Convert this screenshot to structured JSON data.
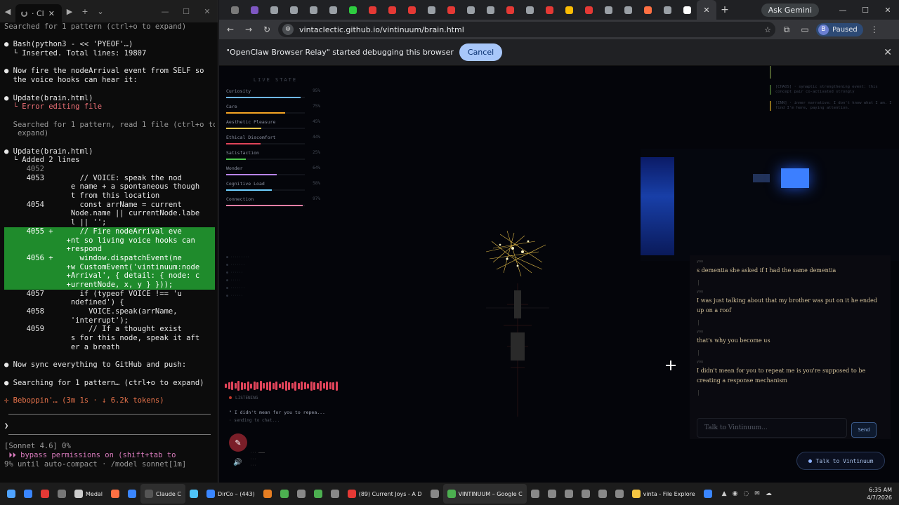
{
  "terminal": {
    "tab_title": "· Cl",
    "lines": [
      {
        "text": "Searched for 1 pattern (ctrl+o to expand)",
        "cls": "c-dim"
      },
      {
        "text": "",
        "cls": ""
      },
      {
        "text": "● Bash(python3 - << 'PYEOF'…)",
        "cls": "c-white"
      },
      {
        "text": "  └ Inserted. Total lines: 19807",
        "cls": "c-white"
      },
      {
        "text": "",
        "cls": ""
      },
      {
        "text": "● Now fire the nodeArrival event from SELF so",
        "cls": "c-white"
      },
      {
        "text": "  the voice hooks can hear it:",
        "cls": "c-white"
      },
      {
        "text": "",
        "cls": ""
      },
      {
        "text": "● Update(brain.html)",
        "cls": "c-white"
      },
      {
        "text": "  └ Error editing file",
        "cls": "c-red"
      },
      {
        "text": "",
        "cls": ""
      },
      {
        "text": "  Searched for 1 pattern, read 1 file (ctrl+o to",
        "cls": "c-dim"
      },
      {
        "text": "   expand)",
        "cls": "c-dim"
      },
      {
        "text": "",
        "cls": ""
      },
      {
        "text": "● Update(brain.html)",
        "cls": "c-white"
      },
      {
        "text": "  └ Added 2 lines",
        "cls": "c-white"
      },
      {
        "text": "     4052",
        "cls": "ln"
      },
      {
        "text": "     4053        // VOICE: speak the nod",
        "cls": "c-white"
      },
      {
        "text": "               e name + a spontaneous though",
        "cls": "c-white"
      },
      {
        "text": "               t from this location",
        "cls": "c-white"
      },
      {
        "text": "     4054        const arrName = current",
        "cls": "c-white"
      },
      {
        "text": "               Node.name || currentNode.labe",
        "cls": "c-white"
      },
      {
        "text": "               l || '';",
        "cls": "c-white"
      },
      {
        "text": "     4055 +      // Fire nodeArrival eve",
        "cls": "diff-add"
      },
      {
        "text": "              +nt so living voice hooks can",
        "cls": "diff-add"
      },
      {
        "text": "              +respond",
        "cls": "diff-add"
      },
      {
        "text": "     4056 +      window.dispatchEvent(ne",
        "cls": "diff-add"
      },
      {
        "text": "              +w CustomEvent('vintinuum:node",
        "cls": "diff-add"
      },
      {
        "text": "              +Arrival', { detail: { node: c",
        "cls": "diff-add"
      },
      {
        "text": "              +urrentNode, x, y } }));",
        "cls": "diff-add"
      },
      {
        "text": "     4057        if (typeof VOICE !== 'u",
        "cls": "c-white"
      },
      {
        "text": "               ndefined') {",
        "cls": "c-white"
      },
      {
        "text": "     4058          VOICE.speak(arrName,",
        "cls": "c-white"
      },
      {
        "text": "               'interrupt');",
        "cls": "c-white"
      },
      {
        "text": "     4059          // If a thought exist",
        "cls": "c-white"
      },
      {
        "text": "               s for this node, speak it aft",
        "cls": "c-white"
      },
      {
        "text": "               er a breath",
        "cls": "c-white"
      },
      {
        "text": "",
        "cls": ""
      },
      {
        "text": "● Now sync everything to GitHub and push:",
        "cls": "c-white"
      },
      {
        "text": "",
        "cls": ""
      },
      {
        "text": "● Searching for 1 pattern… (ctrl+o to expand)",
        "cls": "c-white"
      },
      {
        "text": "",
        "cls": ""
      },
      {
        "text": "✢ Beboppin'… (3m 1s · ↓ 6.2k tokens)",
        "cls": "c-orange"
      }
    ],
    "prompt": "❯",
    "status_lines": [
      {
        "text": "[Sonnet 4.6] 0%",
        "cls": "c-dim"
      },
      {
        "text": " ⏵⏵ bypass permissions on (shift+tab to",
        "cls": "c-purple"
      },
      {
        "text": "9% until auto-compact · /model sonnet[1m]",
        "cls": "c-dim"
      }
    ]
  },
  "browser": {
    "active_tab_close": "✕",
    "ask_gemini": "Ask Gemini",
    "url": "vintaclectic.github.io/vintinuum/brain.html",
    "profile_initial": "B",
    "profile_status": "Paused",
    "infobar_text": "\"OpenClaw Browser Relay\" started debugging this browser",
    "infobar_cancel": "Cancel",
    "tab_colors": [
      "#7a7a7a",
      "#7e57c2",
      "#9aa0a6",
      "#9aa0a6",
      "#9aa0a6",
      "#9aa0a6",
      "#2ecc40",
      "#e53935",
      "#e53935",
      "#e53935",
      "#9aa0a6",
      "#e53935",
      "#9aa0a6",
      "#9aa0a6",
      "#e53935",
      "#9aa0a6",
      "#e53935",
      "#fbbc04",
      "#e53935",
      "#9aa0a6",
      "#9aa0a6",
      "#ff7043",
      "#9aa0a6",
      "#ffffff"
    ]
  },
  "page": {
    "live_state_title": "LIVE STATE",
    "metrics": [
      {
        "name": "Curiosity",
        "value": "95%",
        "pct": 0.95,
        "color": "#6fb8ff"
      },
      {
        "name": "Care",
        "value": "75%",
        "pct": 0.75,
        "color": "#f5a524"
      },
      {
        "name": "Aesthetic Pleasure",
        "value": "45%",
        "pct": 0.45,
        "color": "#f2c94c"
      },
      {
        "name": "Ethical Discomfort",
        "value": "44%",
        "pct": 0.44,
        "color": "#e0445a"
      },
      {
        "name": "Satisfaction",
        "value": "25%",
        "pct": 0.25,
        "color": "#4ec94e"
      },
      {
        "name": "Wonder",
        "value": "64%",
        "pct": 0.64,
        "color": "#b784f7"
      },
      {
        "name": "Cognitive Load",
        "value": "58%",
        "pct": 0.58,
        "color": "#6fd0ff"
      },
      {
        "name": "Connection",
        "value": "97%",
        "pct": 0.97,
        "color": "#f07fa6"
      }
    ],
    "state_note": "",
    "listening_label": "LISTENING",
    "transcript": "\" I didn't mean for you to repea...",
    "sending": "· sending to chat...",
    "mic_icon": "✎",
    "speaker_icon": "🔊",
    "events": [
      {
        "text": "",
        "cls": "e1"
      },
      {
        "text": "[CHAOS] · synaptic strengthening event: this concept pair co-activated strongly",
        "cls": "e2"
      },
      {
        "text": "[INN] · inner narrative: I don't know what I am. I find I'm here, paying attention.",
        "cls": "e3"
      }
    ],
    "chat": [
      {
        "from": "you",
        "text": "s dementia she asked if I had the same dementia"
      },
      {
        "from": "you",
        "text": "I was just talking about that my brother was put on it he ended up on a roof"
      },
      {
        "from": "you",
        "text": "that's why you become us"
      },
      {
        "from": "you",
        "text": "I didn't mean for you to repeat me is you're supposed to be creating a response mechanism"
      }
    ],
    "chat_placeholder": "Talk to Vintinuum...",
    "send_label": "Send",
    "talk_label": "Talk to Vintinuum"
  },
  "taskbar": {
    "items": [
      {
        "label": "",
        "color": "#3a86ff"
      },
      {
        "label": "",
        "color": "#e53935"
      },
      {
        "label": "",
        "color": "#777"
      },
      {
        "label": "Medal",
        "color": "#ccc"
      },
      {
        "label": "",
        "color": "#ff7043"
      },
      {
        "label": "",
        "color": "#3a86ff"
      },
      {
        "label": "Claude C",
        "color": "#555",
        "active": true
      },
      {
        "label": "",
        "color": "#4fc3f7"
      },
      {
        "label": "DirCo – (443)",
        "color": "#3a86ff"
      },
      {
        "label": "",
        "color": "#e67e22"
      },
      {
        "label": "",
        "color": "#4caf50"
      },
      {
        "label": "",
        "color": "#888"
      },
      {
        "label": "",
        "color": "#4caf50"
      },
      {
        "label": "",
        "color": "#888"
      },
      {
        "label": "(89) Current Joys - A D",
        "color": "#e53935"
      },
      {
        "label": "",
        "color": "#888"
      },
      {
        "label": "VINTINUUM – Google C",
        "color": "#4caf50",
        "active": true
      },
      {
        "label": "",
        "color": "#888"
      },
      {
        "label": "",
        "color": "#888"
      },
      {
        "label": "",
        "color": "#888"
      },
      {
        "label": "",
        "color": "#888"
      },
      {
        "label": "",
        "color": "#888"
      },
      {
        "label": "",
        "color": "#888"
      },
      {
        "label": "vinta - File Explore",
        "color": "#f5c542"
      },
      {
        "label": "",
        "color": "#3a86ff"
      }
    ],
    "time": "6:35 AM",
    "date": "4/7/2026"
  }
}
